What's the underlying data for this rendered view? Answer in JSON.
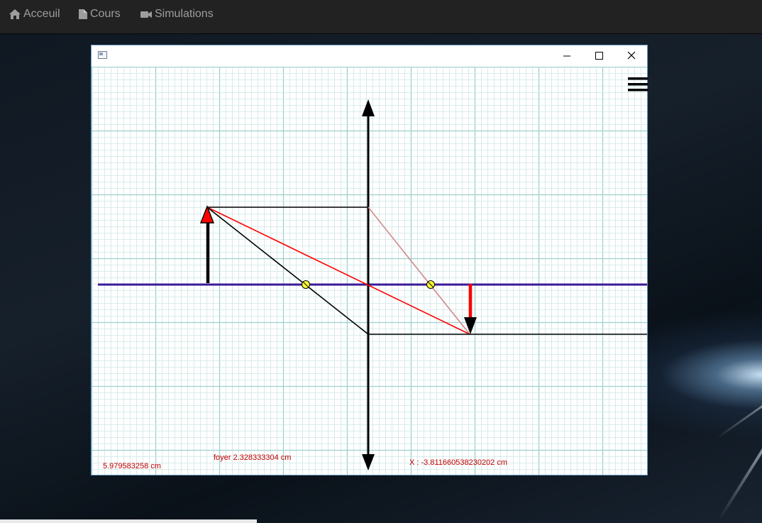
{
  "nav": {
    "items": [
      {
        "label": "Acceuil",
        "icon": "home-icon"
      },
      {
        "label": "Cours",
        "icon": "file-icon"
      },
      {
        "label": "Simulations",
        "icon": "video-camera-icon"
      }
    ]
  },
  "window": {
    "minimize_icon": "minimize-icon",
    "maximize_icon": "maximize-icon",
    "close_icon": "close-icon",
    "menu_icon": "hamburger-menu-icon"
  },
  "readouts": {
    "object_distance": "5.979583258 cm",
    "focal": "foyer 2.328333304 cm",
    "image_position": "X : -3.811660538230202 cm"
  },
  "colors": {
    "grid_minor": "#cfe6e6",
    "grid_major": "#9fcfcf",
    "optical_axis": "#3a1a9a",
    "lens": "#000000",
    "object_arrow": "#000000",
    "image_arrow": "#ff0000",
    "ray_red": "#ff0000",
    "ray_pink": "#d08a8a",
    "focal_point": "#ffff33",
    "readout_text": "#c00000"
  }
}
